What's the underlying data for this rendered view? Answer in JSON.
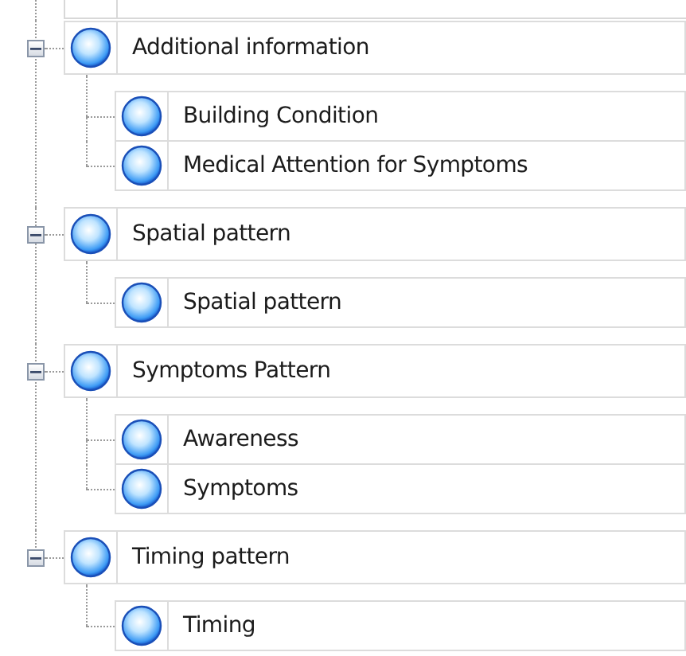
{
  "tree": {
    "items": [
      {
        "label": "Additional information",
        "expanded": true,
        "children": [
          {
            "label": "Building Condition"
          },
          {
            "label": "Medical Attention for Symptoms"
          }
        ]
      },
      {
        "label": "Spatial pattern",
        "expanded": true,
        "children": [
          {
            "label": "Spatial pattern"
          }
        ]
      },
      {
        "label": "Symptoms Pattern",
        "expanded": true,
        "children": [
          {
            "label": "Awareness"
          },
          {
            "label": "Symptoms"
          }
        ]
      },
      {
        "label": "Timing pattern",
        "expanded": true,
        "children": [
          {
            "label": "Timing"
          }
        ]
      }
    ]
  }
}
